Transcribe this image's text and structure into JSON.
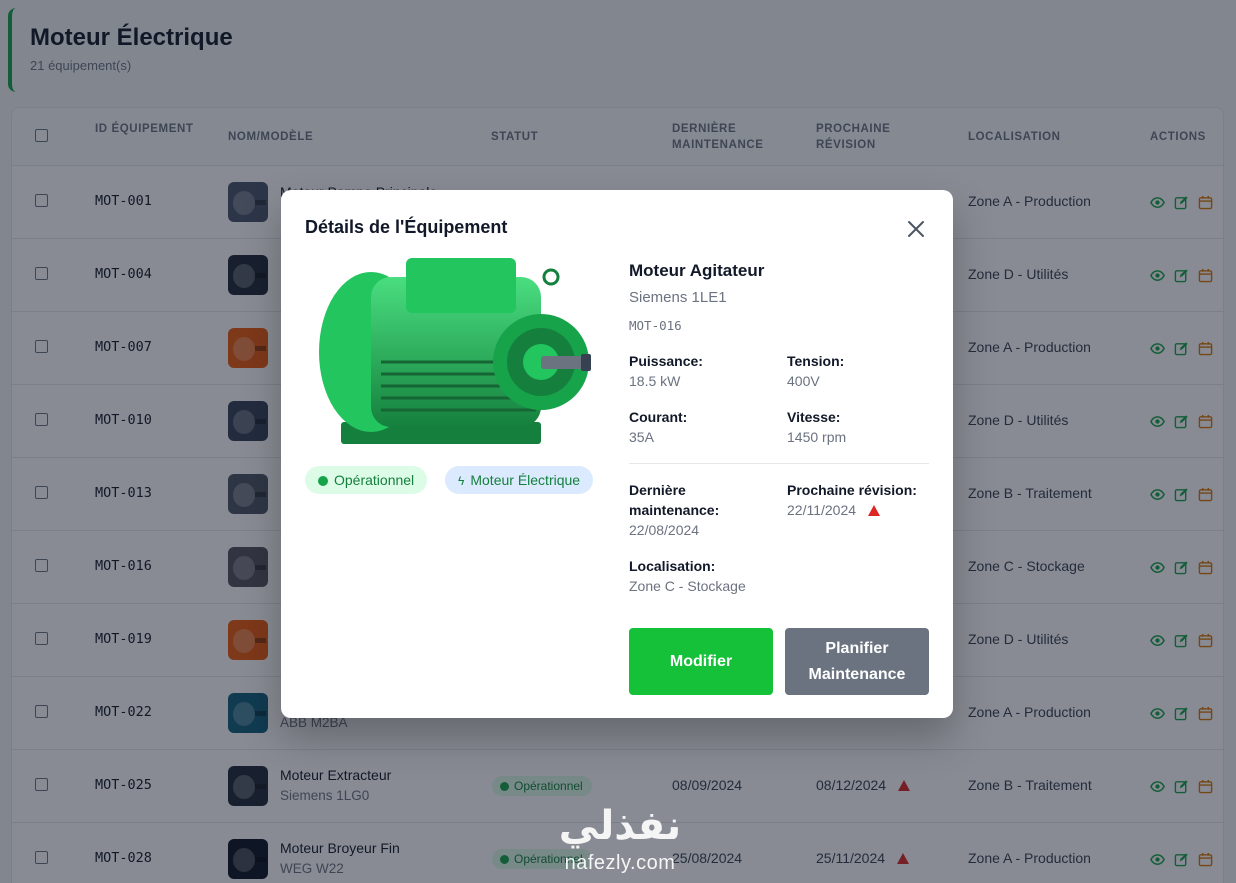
{
  "page": {
    "title": "Moteur Électrique",
    "subtitle": "21 équipement(s)"
  },
  "table": {
    "headers": {
      "id": "ID ÉQUIPEMENT",
      "name": "NOM/MODÈLE",
      "status": "STATUT",
      "last_maint": "DERNIÈRE MAINTENANCE",
      "next_rev": "PROCHAINE RÉVISION",
      "location": "LOCALISATION",
      "actions": "ACTIONS"
    },
    "rows": [
      {
        "id": "MOT-001",
        "name": "Moteur Pompe Principale",
        "model": "",
        "status": "",
        "last": "",
        "next": "",
        "loc": "Zone A - Production",
        "thumb": "#475569"
      },
      {
        "id": "MOT-004",
        "name": "",
        "model": "",
        "status": "",
        "last": "",
        "next": "",
        "loc": "Zone D - Utilités",
        "thumb": "#1f2937"
      },
      {
        "id": "MOT-007",
        "name": "",
        "model": "",
        "status": "",
        "last": "",
        "next": "",
        "loc": "Zone A - Production",
        "thumb": "#ea580c"
      },
      {
        "id": "MOT-010",
        "name": "",
        "model": "",
        "status": "",
        "last": "",
        "next": "",
        "loc": "Zone D - Utilités",
        "thumb": "#334155"
      },
      {
        "id": "MOT-013",
        "name": "",
        "model": "",
        "status": "",
        "last": "",
        "next": "",
        "loc": "Zone B - Traitement",
        "thumb": "#4b5563"
      },
      {
        "id": "MOT-016",
        "name": "",
        "model": "",
        "status": "",
        "last": "",
        "next": "",
        "loc": "Zone C - Stockage",
        "thumb": "#52525b"
      },
      {
        "id": "MOT-019",
        "name": "",
        "model": "",
        "status": "",
        "last": "",
        "next": "",
        "loc": "Zone D - Utilités",
        "thumb": "#ea580c"
      },
      {
        "id": "MOT-022",
        "name": "",
        "model": "ABB M2BA",
        "status": "",
        "last": "",
        "next": "",
        "loc": "Zone A - Production",
        "thumb": "#0f5e7a"
      },
      {
        "id": "MOT-025",
        "name": "Moteur Extracteur",
        "model": "Siemens 1LG0",
        "status": "Opérationnel",
        "last": "08/09/2024",
        "next": "08/12/2024",
        "loc": "Zone B - Traitement",
        "thumb": "#1f2937"
      },
      {
        "id": "MOT-028",
        "name": "Moteur Broyeur Fin",
        "model": "WEG W22",
        "status": "Opérationnel",
        "last": "25/08/2024",
        "next": "25/11/2024",
        "loc": "Zone A - Production",
        "thumb": "#0b1220"
      }
    ]
  },
  "modal": {
    "title": "Détails de l'Équipement",
    "name": "Moteur Agitateur",
    "model": "Siemens 1LE1",
    "id": "MOT-016",
    "status_chip": "Opérationnel",
    "type_chip": "Moteur Électrique",
    "puissance_label": "Puissance:",
    "puissance": "18.5 kW",
    "tension_label": "Tension:",
    "tension": "400V",
    "courant_label": "Courant:",
    "courant": "35A",
    "vitesse_label": "Vitesse:",
    "vitesse": "1450 rpm",
    "derniere_label": "Dernière maintenance:",
    "derniere": "22/08/2024",
    "prochaine_label": "Prochaine révision:",
    "prochaine": "22/11/2024",
    "loc_label": "Localisation:",
    "loc": "Zone C - Stockage",
    "btn_modifier": "Modifier",
    "btn_planifier": "Planifier Maintenance"
  },
  "watermark": {
    "arabic": "نفذلي",
    "latin": "nafezly.com"
  },
  "colors": {
    "accent": "#16a34a",
    "button_green": "#16c13a",
    "button_gray": "#6b7280",
    "warning": "#dc2626",
    "edit_icon": "#16a34a",
    "calendar_icon": "#d97706"
  }
}
